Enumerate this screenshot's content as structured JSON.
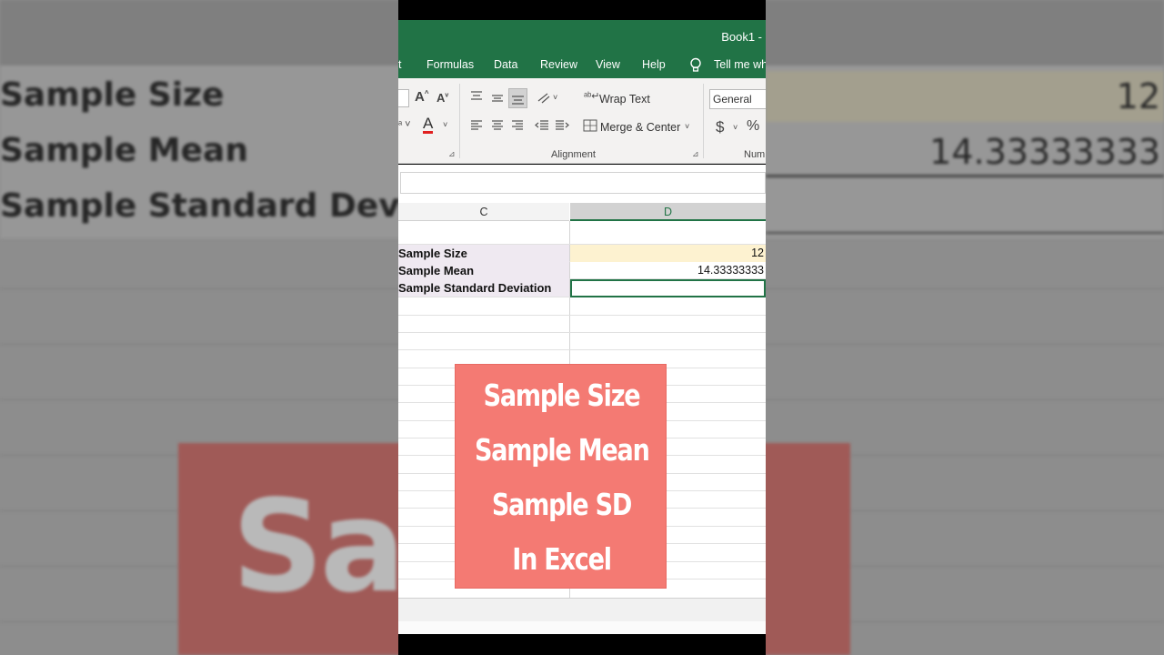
{
  "app": {
    "title": "Book1  -",
    "accent_color": "#217346"
  },
  "ribbon_tabs": [
    "t",
    "Formulas",
    "Data",
    "Review",
    "View",
    "Help",
    "Tell me wha"
  ],
  "ribbon": {
    "wrap_text": "Wrap Text",
    "merge_center": "Merge & Center",
    "alignment_group": "Alignment",
    "number_group": "Num",
    "number_format": "General",
    "currency_symbol": "$",
    "percent_symbol": "%"
  },
  "columns": [
    "C",
    "D"
  ],
  "rows": [
    {
      "label": "Sample Size",
      "value": "12"
    },
    {
      "label": "Sample Mean",
      "value": "14.33333333"
    },
    {
      "label": "Sample Standard Deviation",
      "value": ""
    }
  ],
  "overlay": {
    "lines": [
      "Sample Size",
      "Sample Mean",
      "Sample SD",
      "In Excel"
    ],
    "color": "#f47a73"
  },
  "background": {
    "labels": [
      "Sample Size",
      "Sample Mean",
      "Sample Standard Devia"
    ],
    "values": [
      "12",
      "14.33333333"
    ],
    "big_text": "Sam              e"
  }
}
